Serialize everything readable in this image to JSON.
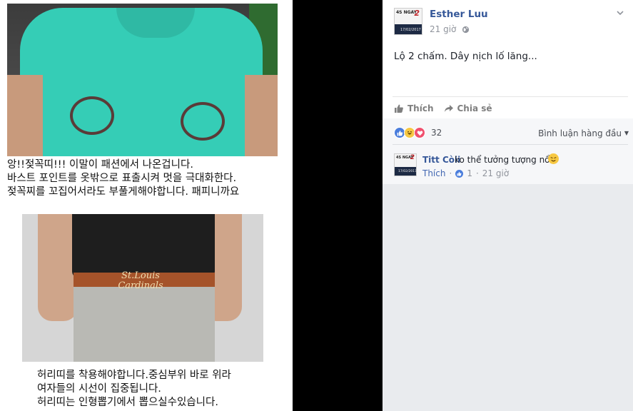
{
  "photo": {
    "korean_top": [
      "앙!!젖꼭띠!!! 이말이 패션에서 나온겁니다.",
      "바스트 포인트를 옷밖으로 표출시켜 멋을 극대화한다.",
      "젖꼭찌를 꼬집어서라도 부풀게해야합니다. 패피니까요"
    ],
    "buckle_text": "St.Louis Cardinals",
    "korean_bottom": [
      "허리띠를 착용해야합니다.중심부위 바로 위라",
      "여자들의 시선이 집중됩니다.",
      "허리띠는 인형뽑기에서 뽑으실수있습니다."
    ]
  },
  "post": {
    "author": "Esther Luu",
    "time": "21 giờ",
    "text": "Lộ 2 chấm. Dây nịch lố lăng...",
    "avatar": {
      "badge": "4S NGAY",
      "number": "2",
      "date": "17/02/2017"
    },
    "actions": {
      "like": "Thích",
      "share": "Chia sẻ"
    }
  },
  "reactions": {
    "count": "32",
    "sort_label": "Bình luận hàng đầu",
    "types": [
      "like-icon",
      "haha-icon",
      "love-icon"
    ]
  },
  "comment": {
    "author": "Titt Còii",
    "text": "ko thể tưởng tượng nổi",
    "like_label": "Thích",
    "like_count": "1",
    "time": "21 giờ",
    "avatar": {
      "badge": "4S NGAY",
      "number": "2",
      "date": "17/02/2017"
    }
  },
  "colors": {
    "link_blue": "#365899",
    "shirt_teal": "#35cdb6",
    "like_blue": "#4a7ddc",
    "page_bg": "#e9ebee"
  }
}
